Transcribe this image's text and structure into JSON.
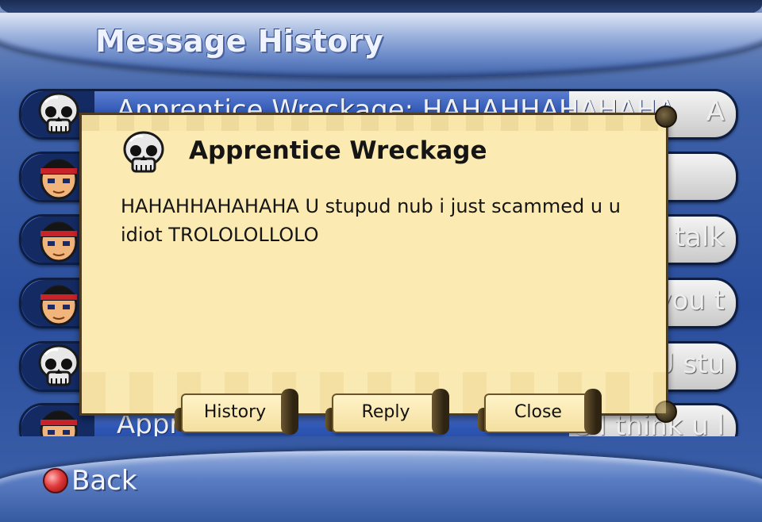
{
  "screen": {
    "title": "Message History",
    "back_label": "Back"
  },
  "messages": [
    {
      "avatar": "skull-icon",
      "text": "Apprentice Wreckage: HAHAHHAHAHAHA",
      "tail": "A"
    },
    {
      "avatar": "player-face-icon",
      "text": "",
      "tail": ""
    },
    {
      "avatar": "player-face-icon",
      "text": "",
      "tail": "f u talk"
    },
    {
      "avatar": "player-face-icon",
      "text": "",
      "tail": "e you t"
    },
    {
      "avatar": "skull-icon",
      "text": "",
      "tail": "A U stu"
    },
    {
      "avatar": "player-face-icon",
      "text": "Appr",
      "tail": "e I think u l"
    }
  ],
  "dialog": {
    "sender": "Apprentice Wreckage",
    "sender_icon": "skull-icon",
    "message": "HAHAHHAHAHAHA U stupud nub i just scammed u u idiot TROLOLOLLOLO",
    "buttons": {
      "history": "History",
      "reply": "Reply",
      "close": "Close"
    }
  }
}
